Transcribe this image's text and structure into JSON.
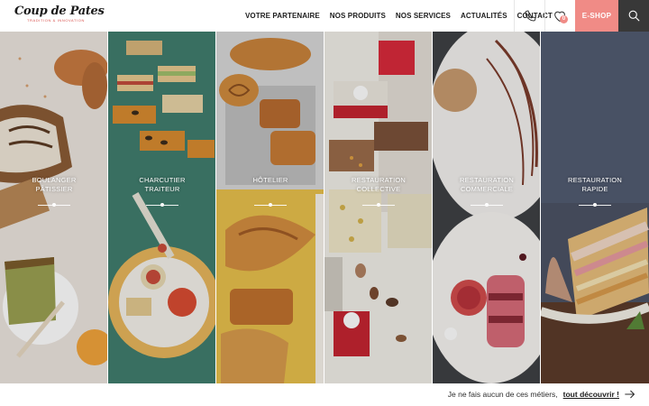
{
  "brand": {
    "logo_text": "Coup de Pates",
    "tagline": "TRADITION & INNOVATION"
  },
  "nav": {
    "items": [
      "VOTRE PARTENAIRE",
      "NOS PRODUITS",
      "NOS SERVICES",
      "ACTUALITÉS",
      "CONTACT"
    ]
  },
  "header": {
    "phone_icon": "phone-icon",
    "heart_icon": "heart-icon",
    "cart_count": "0",
    "eshop_label": "E-SHOP",
    "search_icon": "search-icon"
  },
  "colors": {
    "accent": "#f08b86",
    "dark": "#383838"
  },
  "panels": [
    {
      "title": "BOULANGER\nPÂTISSIER"
    },
    {
      "title": "CHARCUTIER\nTRAITEUR"
    },
    {
      "title": "HÔTELIER"
    },
    {
      "title": "RESTAURATION\nCOLLECTIVE"
    },
    {
      "title": "RESTAURATION\nCOMMERCIALE"
    },
    {
      "title": "RESTAURATION\nRAPIDE"
    }
  ],
  "footer": {
    "text": "Je ne fais aucun de ces métiers,",
    "link": "tout découvrir !"
  }
}
